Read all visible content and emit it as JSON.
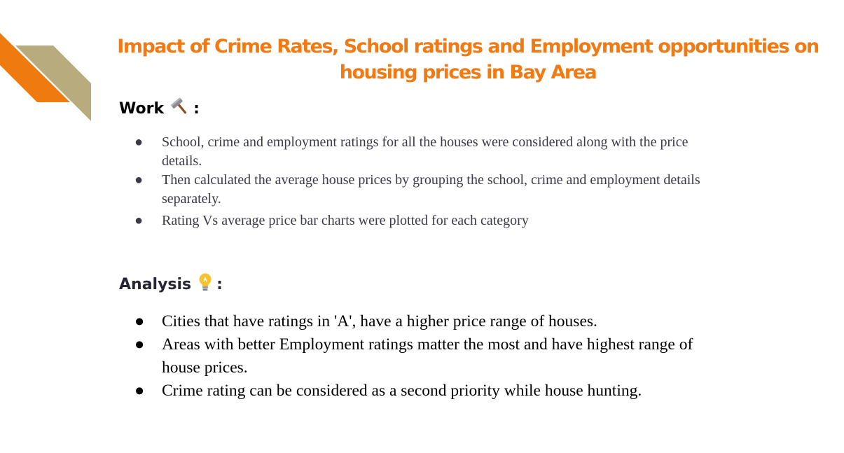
{
  "title": "Impact of Crime Rates, School ratings and Employment opportunities on housing prices in Bay Area",
  "colors": {
    "title": "#f07a14",
    "deco_orange": "#ef7b10",
    "deco_tan": "#b8ac7f"
  },
  "work": {
    "heading": "Work",
    "icon": "hammer-icon",
    "colon": ":",
    "items": [
      "School, crime and employment ratings for all the houses were considered along with the price details.",
      "Then calculated the average house prices by grouping the school, crime and employment details separately.",
      "Rating Vs average price bar charts were plotted for each category"
    ]
  },
  "analysis": {
    "heading": "Analysis",
    "icon": "lightbulb-icon",
    "colon": ":",
    "items": [
      "Cities that have ratings in 'A', have a higher price range of houses.",
      "Areas with better Employment ratings matter the most and have highest range of house prices.",
      "Crime rating can be considered as a second priority while house hunting."
    ]
  }
}
